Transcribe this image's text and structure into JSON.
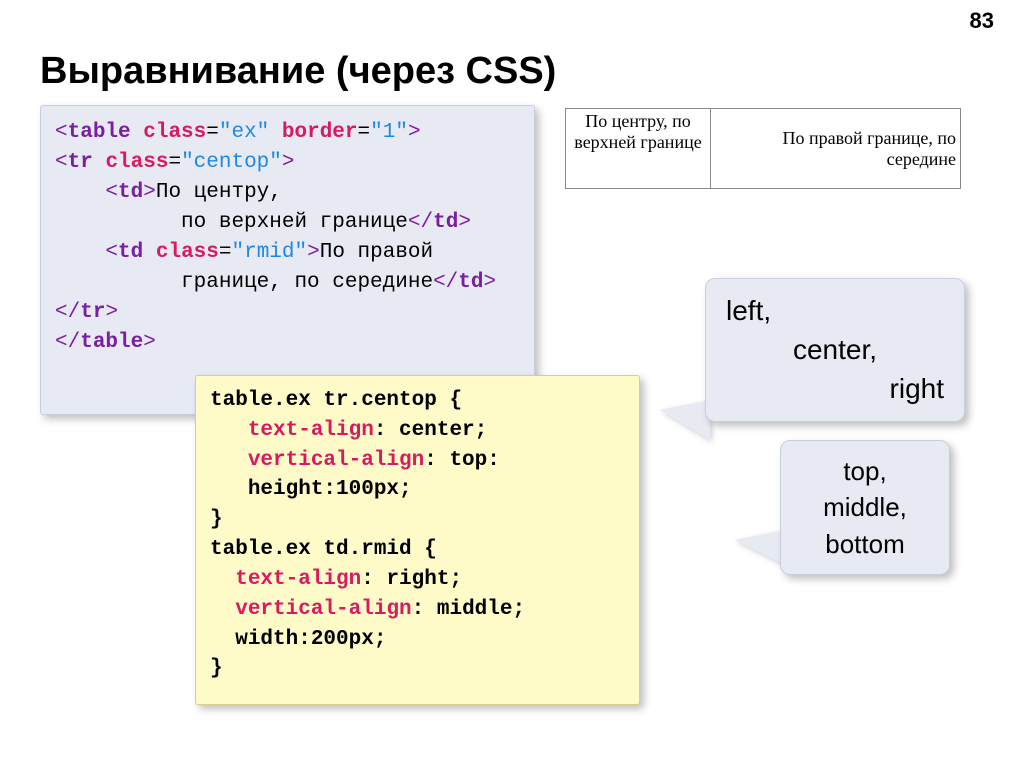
{
  "page_number": "83",
  "title": "Выравнивание (через CSS)",
  "html_code": {
    "l1": {
      "pre": "<",
      "tag": "table",
      "sp": " ",
      "a1": "class",
      "eq1": "=",
      "v1": "\"ex\"",
      "sp2": " ",
      "a2": "border",
      "eq2": "=",
      "v2": "\"1\"",
      "post": ">"
    },
    "l2": {
      "pre": "<",
      "tag": "tr",
      "sp": " ",
      "a1": "class",
      "eq1": "=",
      "v1": "\"centop\"",
      "post": ">"
    },
    "l3": {
      "indent": "    ",
      "pre": "<",
      "tag": "td",
      "post": ">",
      "text": "По центру,"
    },
    "l4": {
      "indent": "          ",
      "text": "по верхней границе",
      "pre": "</",
      "tag": "td",
      "post": ">"
    },
    "l5": {
      "indent": "    ",
      "pre": "<",
      "tag": "td",
      "sp": " ",
      "a1": "class",
      "eq1": "=",
      "v1": "\"rmid\"",
      "post": ">",
      "text": "По правой"
    },
    "l6": {
      "indent": "          ",
      "text": "границе, по середине",
      "pre": "</",
      "tag": "td",
      "post": ">"
    },
    "l7": {
      "pre": "</",
      "tag": "tr",
      "post": ">"
    },
    "l8": {
      "pre": "</",
      "tag": "table",
      "post": ">"
    }
  },
  "css_code": {
    "l1": "table.ex tr.centop {",
    "l2_indent": "   ",
    "l2_prop": "text-align",
    "l2_rest": ": center;",
    "l3_indent": "   ",
    "l3_prop": "vertical-align",
    "l3_rest": ": top:",
    "l4_indent": "   ",
    "l4": "height:100px;",
    "l5": "}",
    "l6": "table.ex td.rmid {",
    "l7_indent": "  ",
    "l7_prop": "text-align",
    "l7_rest": ": right;",
    "l8_indent": "  ",
    "l8_prop": "vertical-align",
    "l8_rest": ": middle;",
    "l9_indent": "  ",
    "l9": "width:200px;",
    "l10": "}"
  },
  "demo": {
    "cell1": "По центру, по верхней границе",
    "cell2": "По правой границе, по середине"
  },
  "callout1": {
    "r1": "left,",
    "r2": "center,",
    "r3": "right"
  },
  "callout2": {
    "r1": "top,",
    "r2": "middle,",
    "r3": "bottom"
  }
}
